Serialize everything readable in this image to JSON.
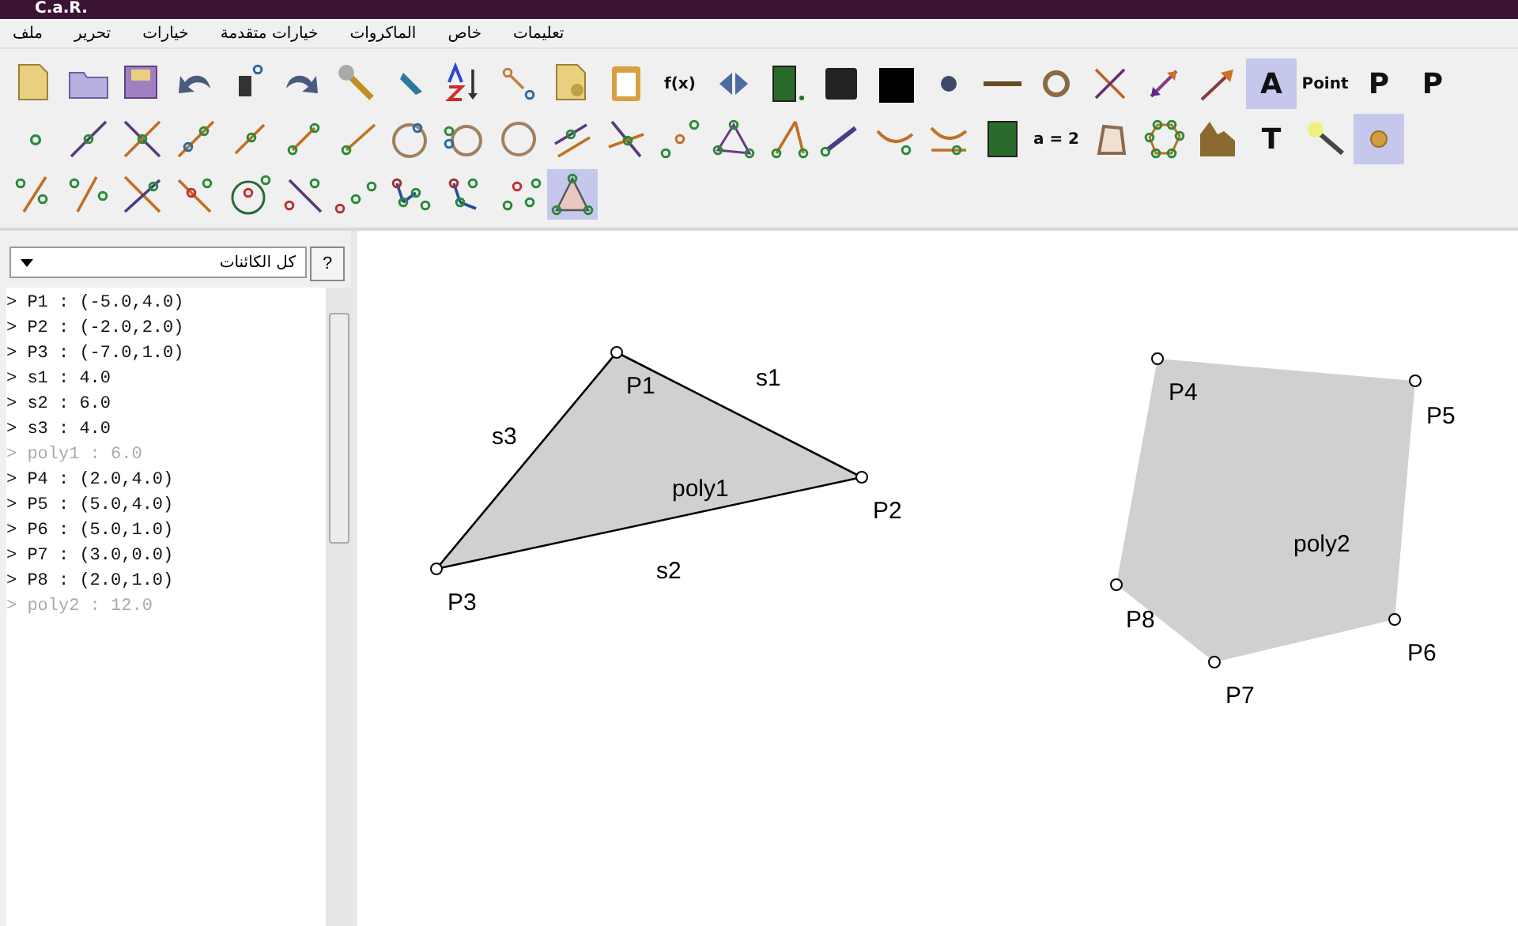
{
  "window": {
    "title": "C.a.R."
  },
  "menu": [
    {
      "label": "تعليمات"
    },
    {
      "label": "خاص"
    },
    {
      "label": "الماكروات"
    },
    {
      "label": "خيارات متقدمة"
    },
    {
      "label": "خيارات"
    },
    {
      "label": "تحرير"
    },
    {
      "label": "ملف"
    }
  ],
  "toolbar": {
    "rows": [
      [
        {
          "kind": "icon",
          "selected": false
        },
        {
          "kind": "icon",
          "selected": false
        },
        {
          "kind": "icon",
          "selected": false
        },
        {
          "kind": "icon",
          "selected": false
        },
        {
          "kind": "icon",
          "selected": false
        },
        {
          "kind": "icon",
          "selected": false
        },
        {
          "kind": "icon",
          "selected": false
        },
        {
          "kind": "icon",
          "selected": false
        },
        {
          "kind": "icon",
          "selected": false
        },
        {
          "kind": "icon",
          "selected": false
        },
        {
          "kind": "icon",
          "selected": false
        },
        {
          "kind": "icon",
          "selected": false
        },
        {
          "kind": "text",
          "label": "f(x)",
          "selected": false
        },
        {
          "kind": "icon",
          "selected": false
        },
        {
          "kind": "icon",
          "selected": false
        },
        {
          "kind": "icon",
          "selected": false
        },
        {
          "kind": "icon",
          "selected": false
        },
        {
          "kind": "icon",
          "selected": false
        },
        {
          "kind": "icon",
          "selected": false
        },
        {
          "kind": "icon",
          "selected": false
        },
        {
          "kind": "icon",
          "selected": false
        },
        {
          "kind": "icon",
          "selected": false
        },
        {
          "kind": "icon",
          "selected": false
        },
        {
          "kind": "text",
          "label": "A",
          "selected": true
        },
        {
          "kind": "text",
          "label": "Point",
          "selected": false
        },
        {
          "kind": "text",
          "label": "P",
          "selected": false
        },
        {
          "kind": "text",
          "label": "P",
          "selected": false
        }
      ],
      [
        {
          "kind": "icon",
          "selected": false
        },
        {
          "kind": "icon",
          "selected": false
        },
        {
          "kind": "icon",
          "selected": false
        },
        {
          "kind": "icon",
          "selected": false
        },
        {
          "kind": "icon",
          "selected": false
        },
        {
          "kind": "icon",
          "selected": false
        },
        {
          "kind": "icon",
          "selected": false
        },
        {
          "kind": "icon",
          "selected": false
        },
        {
          "kind": "icon",
          "selected": false
        },
        {
          "kind": "icon",
          "selected": false
        },
        {
          "kind": "icon",
          "selected": false
        },
        {
          "kind": "icon",
          "selected": false
        },
        {
          "kind": "icon",
          "selected": false
        },
        {
          "kind": "icon",
          "selected": false
        },
        {
          "kind": "icon",
          "selected": false
        },
        {
          "kind": "icon",
          "selected": false
        },
        {
          "kind": "icon",
          "selected": false
        },
        {
          "kind": "icon",
          "selected": false
        },
        {
          "kind": "icon",
          "selected": false
        },
        {
          "kind": "text",
          "label": "a = 2",
          "selected": false
        },
        {
          "kind": "icon",
          "selected": false
        },
        {
          "kind": "icon",
          "selected": false
        },
        {
          "kind": "icon",
          "selected": false
        },
        {
          "kind": "text",
          "label": "T",
          "selected": false
        },
        {
          "kind": "icon",
          "selected": false
        },
        {
          "kind": "icon",
          "selected": true
        }
      ],
      [
        {
          "kind": "icon",
          "selected": false
        },
        {
          "kind": "icon",
          "selected": false
        },
        {
          "kind": "icon",
          "selected": false
        },
        {
          "kind": "icon",
          "selected": false
        },
        {
          "kind": "icon",
          "selected": false
        },
        {
          "kind": "icon",
          "selected": false
        },
        {
          "kind": "icon",
          "selected": false
        },
        {
          "kind": "icon",
          "selected": false
        },
        {
          "kind": "icon",
          "selected": false
        },
        {
          "kind": "icon",
          "selected": false
        },
        {
          "kind": "icon",
          "selected": true
        }
      ]
    ]
  },
  "object_filter": {
    "value": "كل الكائنات",
    "help": "?"
  },
  "objects": [
    {
      "text": "> P1 : (-5.0,4.0)",
      "hidden": false
    },
    {
      "text": "> P2 : (-2.0,2.0)",
      "hidden": false
    },
    {
      "text": "> P3 : (-7.0,1.0)",
      "hidden": false
    },
    {
      "text": "> s1 : 4.0",
      "hidden": false
    },
    {
      "text": "> s2 : 6.0",
      "hidden": false
    },
    {
      "text": "> s3 : 4.0",
      "hidden": false
    },
    {
      "text": "> poly1 : 6.0",
      "hidden": true
    },
    {
      "text": "> P4 : (2.0,4.0)",
      "hidden": false
    },
    {
      "text": "> P5 : (5.0,4.0)",
      "hidden": false
    },
    {
      "text": "> P6 : (5.0,1.0)",
      "hidden": false
    },
    {
      "text": "> P7 : (3.0,0.0)",
      "hidden": false
    },
    {
      "text": "> P8 : (2.0,1.0)",
      "hidden": false
    },
    {
      "text": "> poly2 : 12.0",
      "hidden": true
    }
  ],
  "canvas": {
    "points": [
      {
        "label": "P1"
      },
      {
        "label": "P2"
      },
      {
        "label": "P3"
      },
      {
        "label": "P4"
      },
      {
        "label": "P5"
      },
      {
        "label": "P6"
      },
      {
        "label": "P7"
      },
      {
        "label": "P8"
      }
    ],
    "segments": [
      {
        "label": "s1"
      },
      {
        "label": "s2"
      },
      {
        "label": "s3"
      }
    ],
    "polygons": [
      {
        "label": "poly1"
      },
      {
        "label": "poly2"
      }
    ]
  }
}
